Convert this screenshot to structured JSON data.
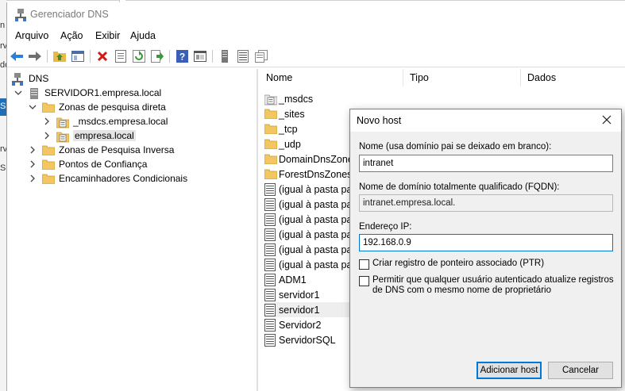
{
  "window": {
    "title": "Gerenciador DNS"
  },
  "background_fragments": [
    "n",
    "rv",
    "do",
    "S",
    "rv",
    "SU"
  ],
  "menu": [
    "Arquivo",
    "Ação",
    "Exibir",
    "Ajuda"
  ],
  "toolbar_icons": [
    "back-arrow-icon",
    "forward-arrow-icon",
    "up-folder-icon",
    "show-tree-icon",
    "delete-icon",
    "properties-icon",
    "refresh-icon",
    "export-icon",
    "help-icon",
    "console-icon",
    "server-icon",
    "list-icon",
    "copy-icon"
  ],
  "tree": {
    "root": "DNS",
    "server": "SERVIDOR1.empresa.local",
    "forward_zones": "Zonas de pesquisa direta",
    "msdcs_zone": "_msdcs.empresa.local",
    "empresa_zone": "empresa.local",
    "reverse_zones": "Zonas de Pesquisa Inversa",
    "trust_points": "Pontos de Confiança",
    "conditional_forwarders": "Encaminhadores Condicionais"
  },
  "list": {
    "columns": [
      "Nome",
      "Tipo",
      "Dados"
    ],
    "rows": [
      {
        "name": "_msdcs",
        "icon": "zone"
      },
      {
        "name": "_sites",
        "icon": "folder"
      },
      {
        "name": "_tcp",
        "icon": "folder"
      },
      {
        "name": "_udp",
        "icon": "folder"
      },
      {
        "name": "DomainDnsZones",
        "icon": "folder"
      },
      {
        "name": "ForestDnsZones",
        "icon": "folder"
      },
      {
        "name": "(igual à pasta pai)",
        "icon": "record"
      },
      {
        "name": "(igual à pasta pai)",
        "icon": "record"
      },
      {
        "name": "(igual à pasta pai)",
        "icon": "record"
      },
      {
        "name": "(igual à pasta pai)",
        "icon": "record"
      },
      {
        "name": "(igual à pasta pai)",
        "icon": "record"
      },
      {
        "name": "(igual à pasta pai)",
        "icon": "record"
      },
      {
        "name": "ADM1",
        "icon": "record"
      },
      {
        "name": "servidor1",
        "icon": "record"
      },
      {
        "name": "servidor1",
        "icon": "record"
      },
      {
        "name": "Servidor2",
        "icon": "record"
      },
      {
        "name": "ServidorSQL",
        "icon": "record"
      }
    ]
  },
  "dialog": {
    "title": "Novo host",
    "name_label": "Nome (usa domínio pai se deixado em branco):",
    "name_value": "intranet",
    "fqdn_label": "Nome de domínio totalmente qualificado (FQDN):",
    "fqdn_value": "intranet.empresa.local.",
    "ip_label": "Endereço IP:",
    "ip_value": "192.168.0.9",
    "ptr_label": "Criar registro de ponteiro associado (PTR)",
    "perm_label": "Permitir que qualquer usuário autenticado atualize registros de DNS com o mesmo nome de proprietário",
    "add_button": "Adicionar host",
    "cancel_button": "Cancelar"
  },
  "colors": {
    "accent": "#0078d7",
    "folder": "#f2c660",
    "desktop_blue": "#1e6fb8"
  }
}
